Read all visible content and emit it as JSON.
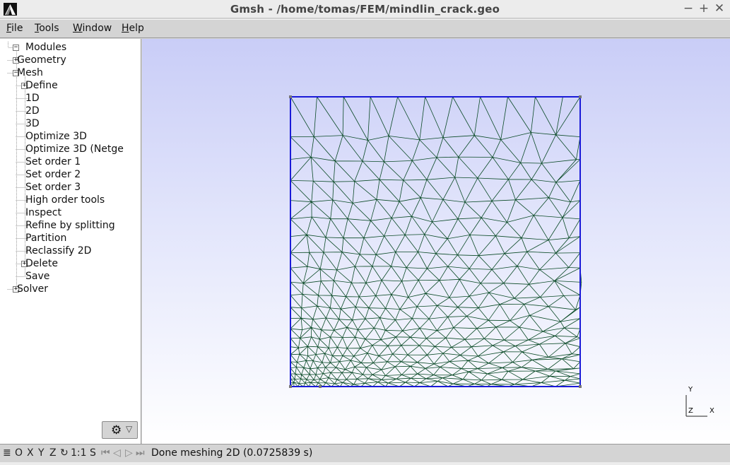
{
  "window": {
    "title": "Gmsh - /home/tomas/FEM/mindlin_crack.geo",
    "minimize": "−",
    "maximize": "+",
    "close": "✕"
  },
  "menu": [
    {
      "first": "F",
      "rest": "ile"
    },
    {
      "first": "T",
      "rest": "ools"
    },
    {
      "first": "W",
      "rest": "indow"
    },
    {
      "first": "H",
      "rest": "elp"
    }
  ],
  "tree": {
    "items": [
      {
        "label": "Modules",
        "depth": 0,
        "box": "−"
      },
      {
        "label": "Geometry",
        "depth": 1,
        "box": "+"
      },
      {
        "label": "Mesh",
        "depth": 1,
        "box": "−"
      },
      {
        "label": "Define",
        "depth": 2,
        "box": "+"
      },
      {
        "label": "1D",
        "depth": 2,
        "box": ""
      },
      {
        "label": "2D",
        "depth": 2,
        "box": ""
      },
      {
        "label": "3D",
        "depth": 2,
        "box": ""
      },
      {
        "label": "Optimize 3D",
        "depth": 2,
        "box": ""
      },
      {
        "label": "Optimize 3D (Netge",
        "depth": 2,
        "box": ""
      },
      {
        "label": "Set order 1",
        "depth": 2,
        "box": ""
      },
      {
        "label": "Set order 2",
        "depth": 2,
        "box": ""
      },
      {
        "label": "Set order 3",
        "depth": 2,
        "box": ""
      },
      {
        "label": "High order tools",
        "depth": 2,
        "box": ""
      },
      {
        "label": "Inspect",
        "depth": 2,
        "box": ""
      },
      {
        "label": "Refine by splitting",
        "depth": 2,
        "box": ""
      },
      {
        "label": "Partition",
        "depth": 2,
        "box": ""
      },
      {
        "label": "Reclassify 2D",
        "depth": 2,
        "box": ""
      },
      {
        "label": "Delete",
        "depth": 2,
        "box": "+"
      },
      {
        "label": "Save",
        "depth": 2,
        "box": ""
      },
      {
        "label": "Solver",
        "depth": 1,
        "box": "+"
      }
    ]
  },
  "settings_button": {
    "gear": "⚙",
    "arrow": "▽"
  },
  "axes": {
    "y": "Y",
    "z": "Z",
    "x": "X"
  },
  "statusbar": {
    "menu_icon": "≣",
    "o": "O",
    "x": "X",
    "y": "Y",
    "z": "Z",
    "rotate": "↻",
    "scale": "1:1",
    "s": "S",
    "first": "⏮",
    "prev": "◁",
    "play": "▷",
    "last": "⏭",
    "message": "Done meshing 2D (0.0725839 s)"
  },
  "colors": {
    "mesh_line": "#0a4a26",
    "boundary": "#1a1ad8",
    "point": "#777777"
  }
}
